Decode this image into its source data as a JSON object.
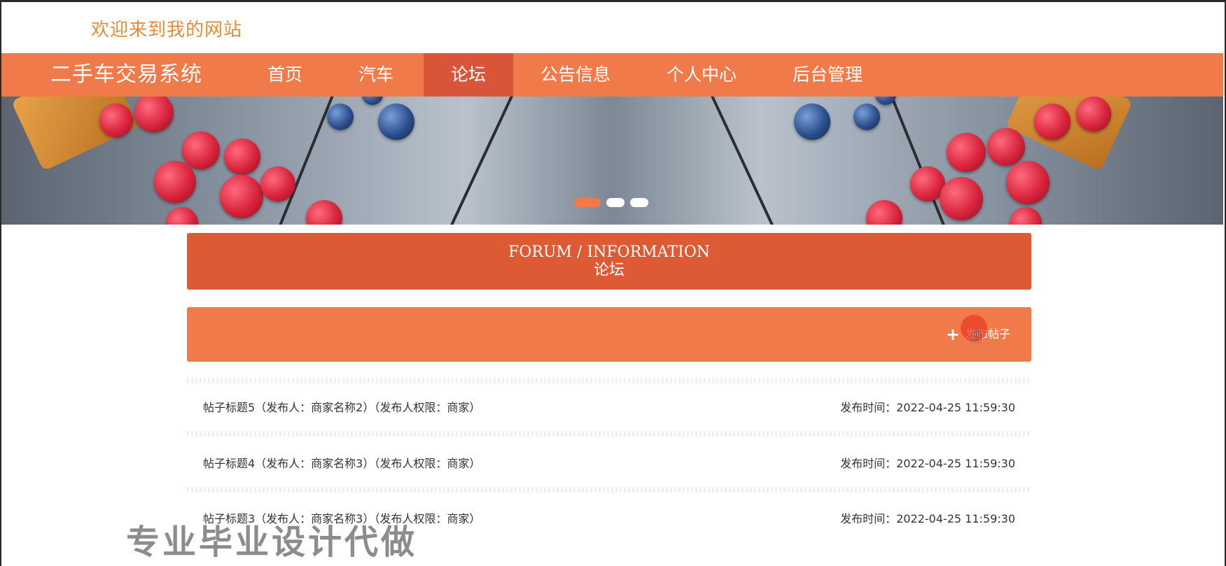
{
  "header": {
    "welcome_text": "欢迎来到我的网站"
  },
  "nav": {
    "brand": "二手车交易系统",
    "items": [
      {
        "label": "首页",
        "active": false
      },
      {
        "label": "汽车",
        "active": false
      },
      {
        "label": "论坛",
        "active": true
      },
      {
        "label": "公告信息",
        "active": false
      },
      {
        "label": "个人中心",
        "active": false
      },
      {
        "label": "后台管理",
        "active": false
      }
    ]
  },
  "banner": {
    "slides": 3,
    "active_slide": 1
  },
  "section": {
    "title_en": "FORUM / INFORMATION",
    "title_cn": "论坛"
  },
  "actions": {
    "new_post_label": "发布帖子",
    "new_post_icon": "plus-icon"
  },
  "posts": [
    {
      "title": "帖子标题5（发布人：商家名称2）（发布人权限：商家）",
      "time": "发布时间：2022-04-25 11:59:30"
    },
    {
      "title": "帖子标题4（发布人：商家名称3）（发布人权限：商家）",
      "time": "发布时间：2022-04-25 11:59:30"
    },
    {
      "title": "帖子标题3（发布人：商家名称3）（发布人权限：商家）",
      "time": "发布时间：2022-04-25 11:59:30"
    }
  ],
  "watermark": "专业毕业设计代做",
  "colors": {
    "primary": "#f07a4a",
    "primary_dark": "#dd5a34",
    "welcome": "#e88a3a"
  }
}
